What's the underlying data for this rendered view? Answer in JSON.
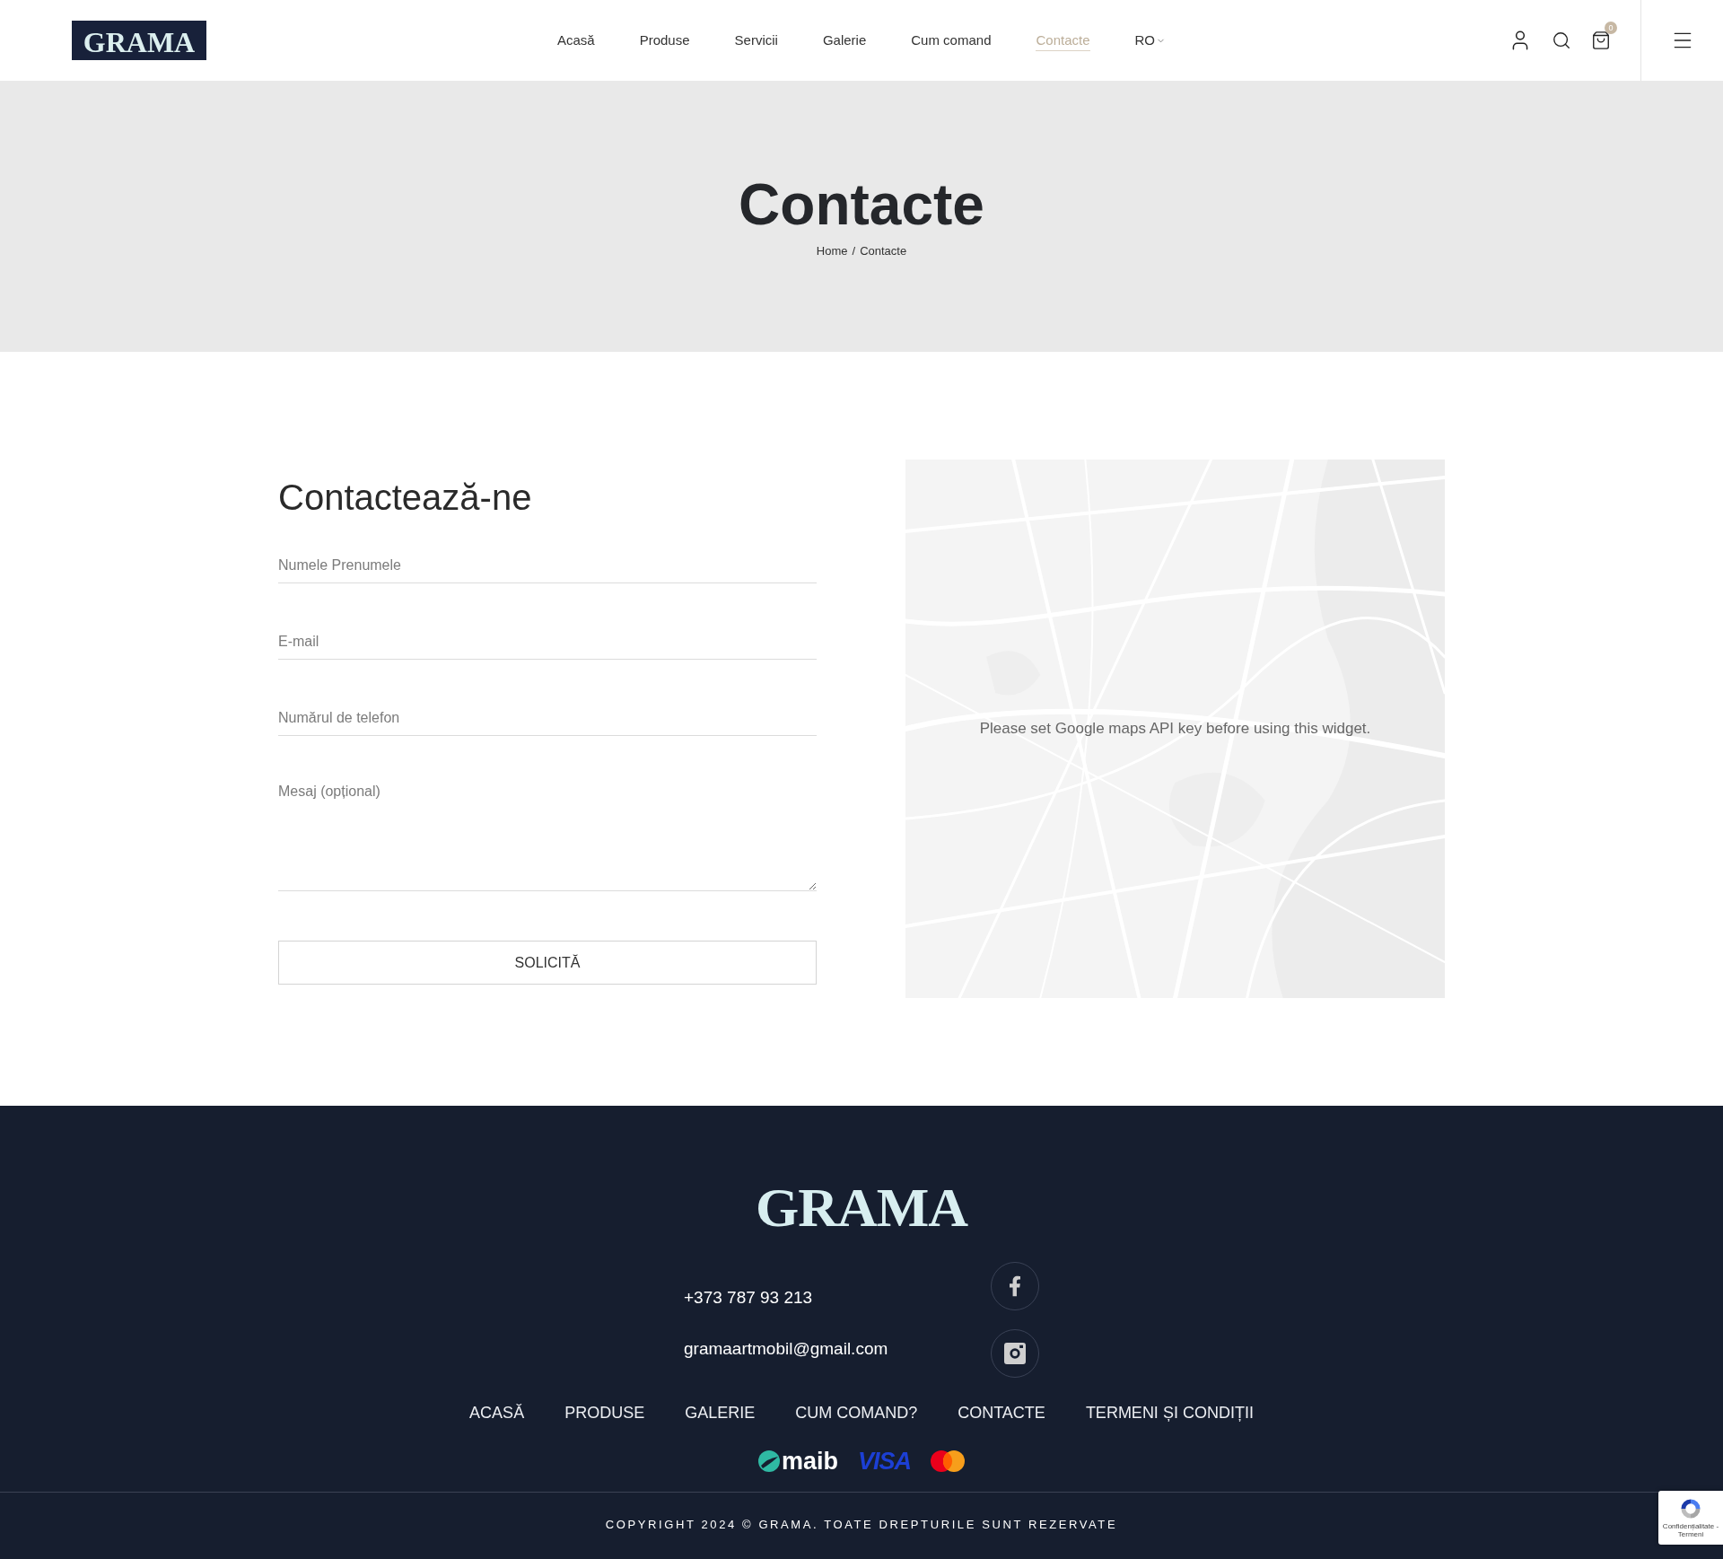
{
  "header": {
    "logo": "GRAMA",
    "nav": [
      {
        "label": "Acasă",
        "selected": false
      },
      {
        "label": "Produse",
        "selected": false
      },
      {
        "label": "Servicii",
        "selected": false
      },
      {
        "label": "Galerie",
        "selected": false
      },
      {
        "label": "Cum comand",
        "selected": false
      },
      {
        "label": "Contacte",
        "selected": true
      }
    ],
    "language": "RO",
    "cart_count": "0"
  },
  "hero": {
    "title": "Contacte",
    "breadcrumb": [
      "Home",
      "Contacte"
    ],
    "breadcrumb_separator": "/"
  },
  "contact_form": {
    "title": "Contactează-ne",
    "fields": [
      {
        "kind": "input",
        "placeholder": "Numele Prenumele"
      },
      {
        "kind": "input",
        "placeholder": "E-mail"
      },
      {
        "kind": "input",
        "placeholder": "Numărul de telefon"
      },
      {
        "kind": "textarea",
        "placeholder": "Mesaj (opțional)"
      }
    ],
    "submit_label": "SOLICITĂ"
  },
  "map": {
    "message": "Please set Google maps API key before using this widget."
  },
  "footer": {
    "logo": "GRAMA",
    "phone": "+373 787 93 213",
    "email": "gramaartmobil@gmail.com",
    "social": [
      {
        "kind": "facebook"
      },
      {
        "kind": "instagram"
      }
    ],
    "links": [
      "ACASĂ",
      "PRODUSE",
      "GALERIE",
      "CUM COMAND?",
      "CONTACTE",
      "TERMENI ȘI CONDIȚII"
    ],
    "payment_methods": [
      {
        "kind": "maib",
        "label": "maib"
      },
      {
        "kind": "visa",
        "label": "VISA"
      },
      {
        "kind": "mastercard"
      }
    ],
    "copyright": "COPYRIGHT 2024 © GRAMA. TOATE DREPTURILE SUNT REZERVATE"
  },
  "recaptcha": {
    "caption": "Confidențialitate - Termeni"
  }
}
